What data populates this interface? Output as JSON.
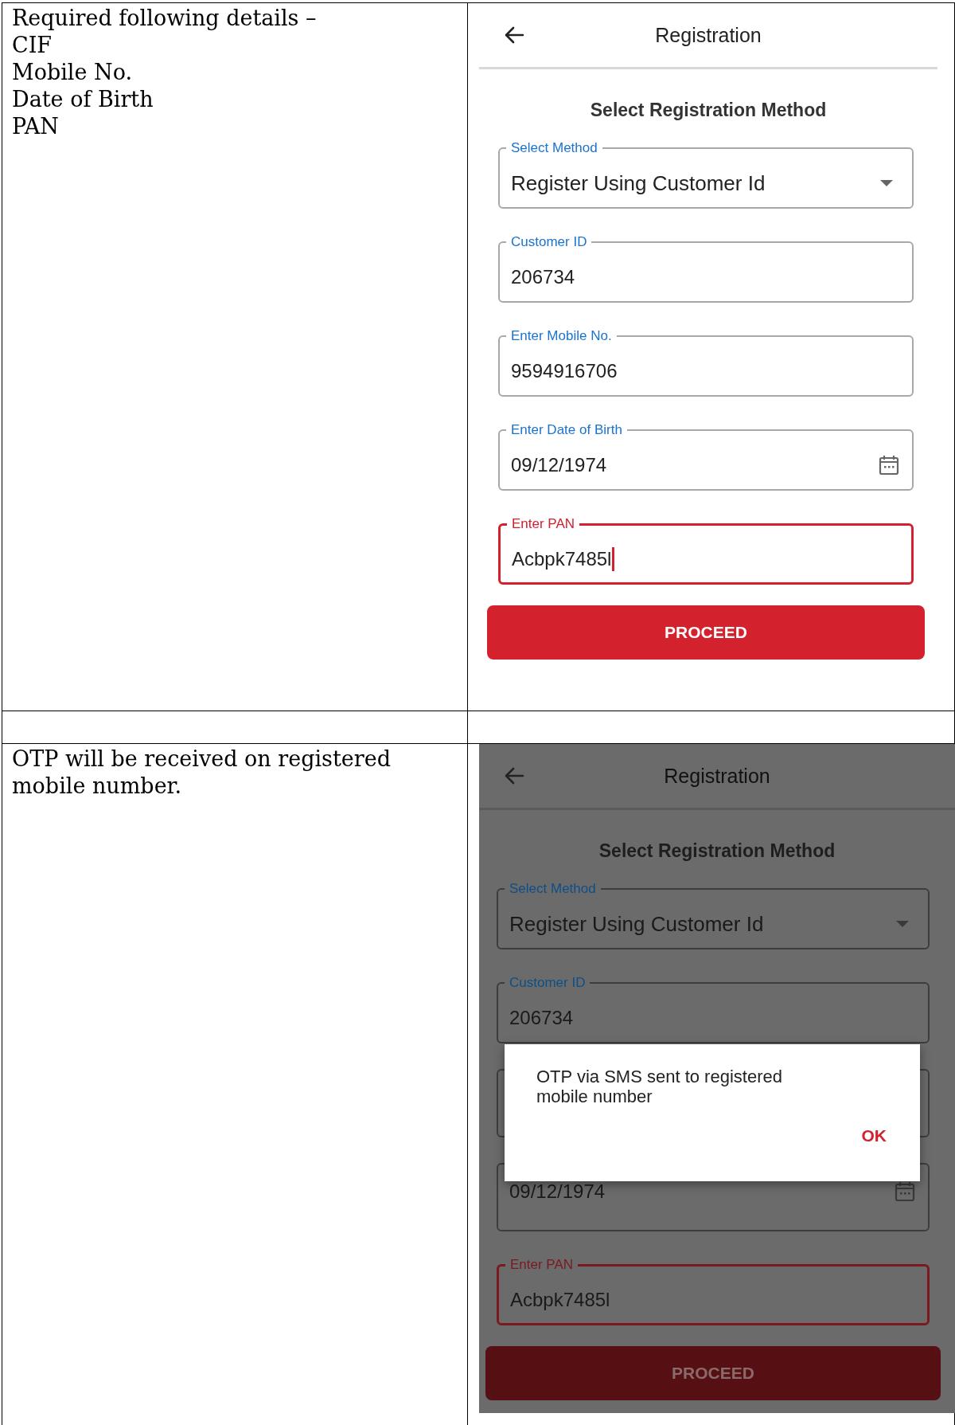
{
  "rows": [
    {
      "description": [
        "Required following details –",
        "CIF",
        "Mobile No.",
        "Date of Birth",
        "PAN"
      ],
      "screen": {
        "dimmed": false,
        "title": "Registration",
        "heading": "Select Registration Method",
        "fields": [
          {
            "kind": "select",
            "label": "Select Method",
            "value": "Register Using Customer Id",
            "focused": false
          },
          {
            "kind": "text",
            "label": "Customer ID",
            "value": "206734",
            "focused": false
          },
          {
            "kind": "text",
            "label": "Enter Mobile No.",
            "value": "9594916706",
            "focused": false
          },
          {
            "kind": "date",
            "label": "Enter Date of Birth",
            "value": "09/12/1974",
            "focused": false
          },
          {
            "kind": "text",
            "label": "Enter PAN",
            "value": "Acbpk7485l",
            "focused": true,
            "cursor": true
          }
        ],
        "button": "PROCEED"
      }
    },
    {
      "description": []
    },
    {
      "description": [
        "OTP will be received on registered mobile number."
      ],
      "screen": {
        "dimmed": true,
        "title": "Registration",
        "heading": "Select Registration Method",
        "fields": [
          {
            "kind": "select",
            "label": "Select Method",
            "value": "Register Using Customer Id",
            "focused": false
          },
          {
            "kind": "text",
            "label": "Customer ID",
            "value": "206734",
            "focused": false
          },
          {
            "kind": "text",
            "focused": false
          },
          {
            "kind": "date",
            "value": "09/12/1974",
            "focused": false
          },
          {
            "kind": "text",
            "label": "Enter PAN",
            "value": "Acbpk7485l",
            "focused": true,
            "cursor": false
          }
        ],
        "button": "PROCEED",
        "dialog": {
          "message": "OTP via SMS sent to registered mobile number",
          "button": "OK"
        }
      }
    }
  ]
}
